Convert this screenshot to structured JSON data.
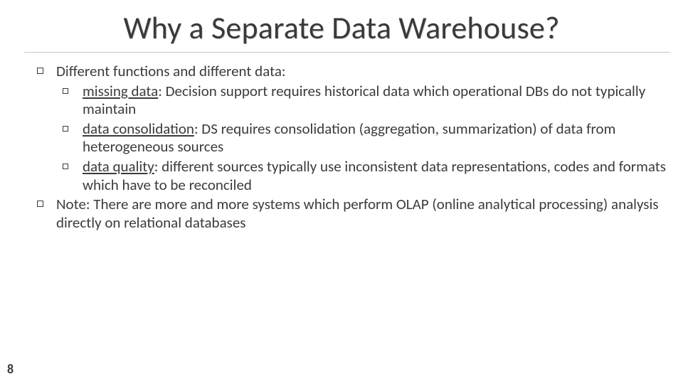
{
  "title": "Why a Separate Data Warehouse?",
  "bullets": {
    "b1": "Different functions and different data:",
    "s1_term": "missing data",
    "s1_rest": ": Decision support requires historical data which operational DBs do not typically maintain",
    "s2_term": "data consolidation",
    "s2_rest": ":  DS requires consolidation (aggregation, summarization) of data from heterogeneous sources",
    "s3_term": "data quality",
    "s3_rest": ": different sources typically use inconsistent data representations, codes and formats which have to be reconciled",
    "b2": "Note: There are more and more systems which perform OLAP  (online analytical processing) analysis directly on relational databases"
  },
  "page_number": "8"
}
